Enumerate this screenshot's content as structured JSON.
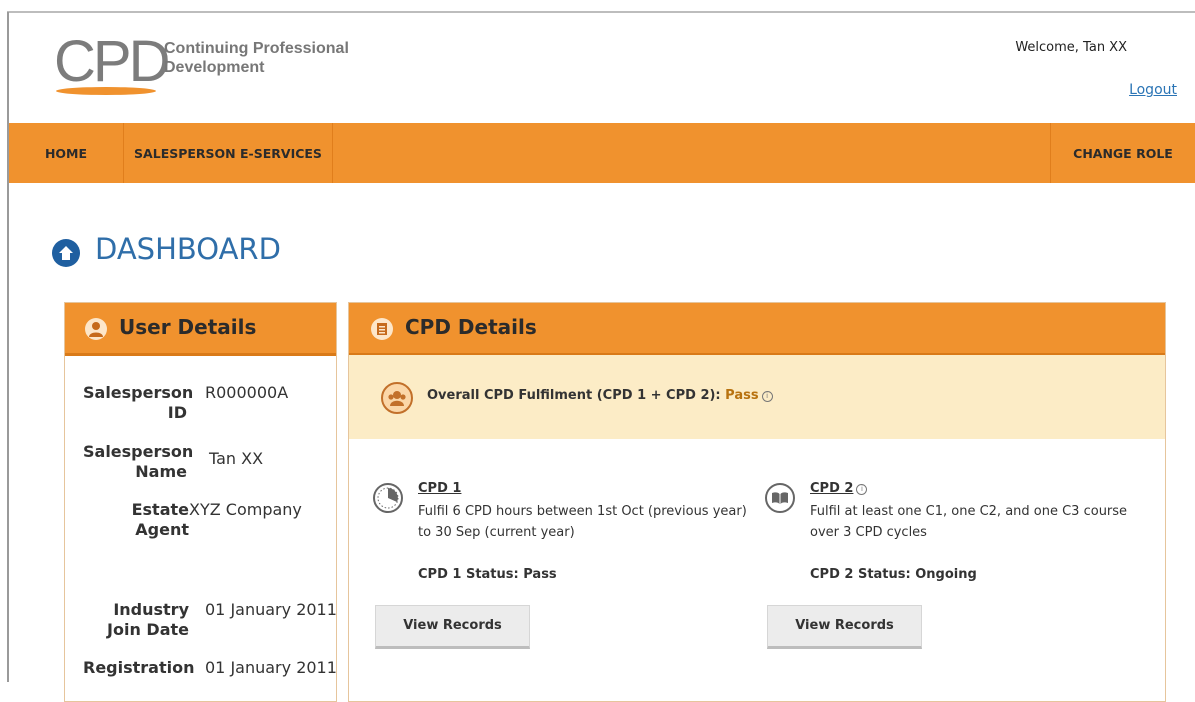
{
  "header": {
    "logo_text": "CPD",
    "logo_subtitle_line1": "Continuing Professional",
    "logo_subtitle_line2": "Development",
    "welcome": "Welcome,  Tan XX",
    "logout": "Logout"
  },
  "nav": {
    "home": "HOME",
    "salesperson": "SALESPERSON E-SERVICES",
    "change_role": "CHANGE ROLE"
  },
  "page_title": "DASHBOARD",
  "user_details": {
    "title": "User Details",
    "rows": [
      {
        "label": "Salesperson ID",
        "value": "R000000A"
      },
      {
        "label": "Salesperson Name",
        "value": "Tan XX"
      },
      {
        "label": "Estate Agent",
        "value": "XYZ Company"
      },
      {
        "label": "Industry Join Date",
        "value": "01 January 2011"
      },
      {
        "label": "Registration",
        "value": "01 January 2011"
      }
    ]
  },
  "cpd_details": {
    "title": "CPD Details",
    "overall_label": "Overall CPD Fulfilment (CPD 1 + CPD 2): ",
    "overall_status": "Pass",
    "cpd1": {
      "title": "CPD 1",
      "description": "Fulfil 6 CPD hours between 1st Oct (previous year) to 30 Sep (current year)",
      "status": "CPD 1 Status: Pass",
      "button": "View Records"
    },
    "cpd2": {
      "title": "CPD 2",
      "description": "Fulfil at least one C1, one C2, and one C3 course over 3 CPD cycles",
      "status": "CPD 2 Status: Ongoing",
      "button": "View Records"
    }
  },
  "colors": {
    "orange": "#f0922e",
    "blue": "#2f6ea9",
    "highlight": "#fcecc6"
  }
}
